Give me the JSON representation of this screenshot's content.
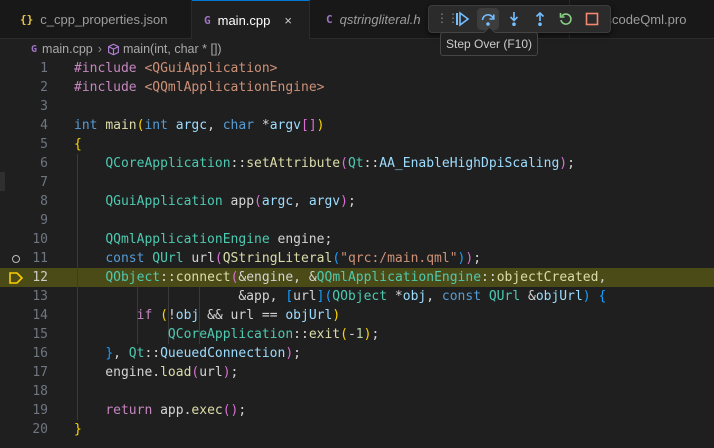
{
  "tabs": [
    {
      "icon": "{}",
      "label": "c_cpp_properties.json",
      "active": false
    },
    {
      "icon": "G",
      "label": "main.cpp",
      "active": true,
      "close": "×"
    },
    {
      "icon": "C",
      "label": "qstringliteral.h",
      "active": false
    },
    {
      "icon": "",
      "label": "vscodeQml.pro",
      "active": false
    }
  ],
  "debug_toolbar": {
    "buttons": [
      "continue-icon",
      "step-over-icon",
      "step-into-icon",
      "step-out-icon",
      "restart-icon",
      "stop-icon"
    ],
    "colors": {
      "primary": "#75beff",
      "restart": "#89d185",
      "stop": "#f48771"
    }
  },
  "tooltip": {
    "text": "Step Over (F10)"
  },
  "breadcrumb": {
    "file_icon": "G",
    "file": "main.cpp",
    "sep": "›",
    "symbol_icon": "cube-icon",
    "symbol": "main(int, char * [])"
  },
  "editor": {
    "current_line": 12,
    "breakpoint_line": 11,
    "lines": [
      {
        "n": "1"
      },
      {
        "n": "2"
      },
      {
        "n": "3"
      },
      {
        "n": "4"
      },
      {
        "n": "5"
      },
      {
        "n": "6"
      },
      {
        "n": "7"
      },
      {
        "n": "8"
      },
      {
        "n": "9"
      },
      {
        "n": "10"
      },
      {
        "n": "11"
      },
      {
        "n": "12"
      },
      {
        "n": "13"
      },
      {
        "n": "14"
      },
      {
        "n": "15"
      },
      {
        "n": "16"
      },
      {
        "n": "17"
      },
      {
        "n": "18"
      },
      {
        "n": "19"
      },
      {
        "n": "20"
      }
    ],
    "code": [
      [
        [
          "c-dir",
          "#include "
        ],
        [
          "c-inc",
          "<QGuiApplication>"
        ]
      ],
      [
        [
          "c-dir",
          "#include "
        ],
        [
          "c-inc",
          "<QQmlApplicationEngine>"
        ]
      ],
      [],
      [
        [
          "c-kw",
          "int "
        ],
        [
          "c-fn",
          "main"
        ],
        [
          "c-br",
          "("
        ],
        [
          "c-kw",
          "int "
        ],
        [
          "c-var",
          "argc"
        ],
        [
          "c-pun",
          ", "
        ],
        [
          "c-kw",
          "char "
        ],
        [
          "c-pun",
          "*"
        ],
        [
          "c-var",
          "argv"
        ],
        [
          "c-br2",
          "[]"
        ],
        [
          "c-br",
          ")"
        ]
      ],
      [
        [
          "c-br",
          "{"
        ]
      ],
      [
        [
          "c-pun",
          "    "
        ],
        [
          "c-ty",
          "QCoreApplication"
        ],
        [
          "c-pun",
          "::"
        ],
        [
          "c-fn",
          "setAttribute"
        ],
        [
          "c-br2",
          "("
        ],
        [
          "c-ty",
          "Qt"
        ],
        [
          "c-pun",
          "::"
        ],
        [
          "c-var",
          "AA_EnableHighDpiScaling"
        ],
        [
          "c-br2",
          ")"
        ],
        [
          "c-pun",
          ";"
        ]
      ],
      [],
      [
        [
          "c-pun",
          "    "
        ],
        [
          "c-ty",
          "QGuiApplication "
        ],
        [
          "c-pun",
          "app"
        ],
        [
          "c-br2",
          "("
        ],
        [
          "c-var",
          "argc"
        ],
        [
          "c-pun",
          ", "
        ],
        [
          "c-var",
          "argv"
        ],
        [
          "c-br2",
          ")"
        ],
        [
          "c-pun",
          ";"
        ]
      ],
      [],
      [
        [
          "c-pun",
          "    "
        ],
        [
          "c-ty",
          "QQmlApplicationEngine "
        ],
        [
          "c-pun",
          "engine;"
        ]
      ],
      [
        [
          "c-pun",
          "    "
        ],
        [
          "c-kw",
          "const "
        ],
        [
          "c-ty",
          "QUrl "
        ],
        [
          "c-pun",
          "url"
        ],
        [
          "c-br2",
          "("
        ],
        [
          "c-fn",
          "QStringLiteral"
        ],
        [
          "c-br3",
          "("
        ],
        [
          "c-str",
          "\"qrc:/main.qml\""
        ],
        [
          "c-br3",
          ")"
        ],
        [
          "c-br2",
          ")"
        ],
        [
          "c-pun",
          ";"
        ]
      ],
      [
        [
          "c-pun",
          "    "
        ],
        [
          "c-ty",
          "QObject"
        ],
        [
          "c-pun",
          "::"
        ],
        [
          "c-fn",
          "connect"
        ],
        [
          "c-br2",
          "("
        ],
        [
          "c-pun",
          "&engine, &"
        ],
        [
          "c-ty",
          "QQmlApplicationEngine"
        ],
        [
          "c-pun",
          "::"
        ],
        [
          "c-fn",
          "objectCreated"
        ],
        [
          "c-pun",
          ","
        ]
      ],
      [
        [
          "c-pun",
          "                     &app, "
        ],
        [
          "c-br3",
          "["
        ],
        [
          "c-pun",
          "url"
        ],
        [
          "c-br3",
          "]"
        ],
        [
          "c-br3",
          "("
        ],
        [
          "c-ty",
          "QObject "
        ],
        [
          "c-pun",
          "*"
        ],
        [
          "c-var",
          "obj"
        ],
        [
          "c-pun",
          ", "
        ],
        [
          "c-kw",
          "const "
        ],
        [
          "c-ty",
          "QUrl "
        ],
        [
          "c-pun",
          "&"
        ],
        [
          "c-var",
          "objUrl"
        ],
        [
          "c-br3",
          ")"
        ],
        [
          "c-pun",
          " "
        ],
        [
          "c-br3",
          "{"
        ]
      ],
      [
        [
          "c-pun",
          "        "
        ],
        [
          "c-dir",
          "if "
        ],
        [
          "c-br",
          "("
        ],
        [
          "c-pun",
          "!"
        ],
        [
          "c-var",
          "obj"
        ],
        [
          "c-pun",
          " && url == "
        ],
        [
          "c-var",
          "objUrl"
        ],
        [
          "c-br",
          ")"
        ]
      ],
      [
        [
          "c-pun",
          "            "
        ],
        [
          "c-ty",
          "QCoreApplication"
        ],
        [
          "c-pun",
          "::"
        ],
        [
          "c-fn",
          "exit"
        ],
        [
          "c-br",
          "("
        ],
        [
          "c-pun",
          "-"
        ],
        [
          "c-num",
          "1"
        ],
        [
          "c-br",
          ")"
        ],
        [
          "c-pun",
          ";"
        ]
      ],
      [
        [
          "c-pun",
          "    "
        ],
        [
          "c-br3",
          "}"
        ],
        [
          "c-pun",
          ", "
        ],
        [
          "c-ty",
          "Qt"
        ],
        [
          "c-pun",
          "::"
        ],
        [
          "c-var",
          "QueuedConnection"
        ],
        [
          "c-br2",
          ")"
        ],
        [
          "c-pun",
          ";"
        ]
      ],
      [
        [
          "c-pun",
          "    engine."
        ],
        [
          "c-fn",
          "load"
        ],
        [
          "c-br2",
          "("
        ],
        [
          "c-pun",
          "url"
        ],
        [
          "c-br2",
          ")"
        ],
        [
          "c-pun",
          ";"
        ]
      ],
      [],
      [
        [
          "c-pun",
          "    "
        ],
        [
          "c-dir",
          "return "
        ],
        [
          "c-pun",
          "app."
        ],
        [
          "c-fn",
          "exec"
        ],
        [
          "c-br2",
          "()"
        ],
        [
          "c-pun",
          ";"
        ]
      ],
      [
        [
          "c-br",
          "}"
        ]
      ]
    ]
  }
}
